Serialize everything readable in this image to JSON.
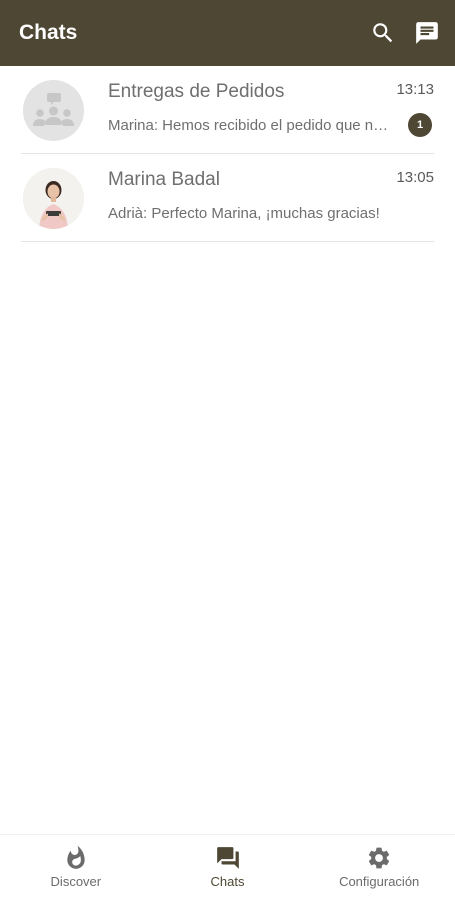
{
  "appbar": {
    "title": "Chats",
    "icons": [
      "search-icon",
      "new-message-icon"
    ]
  },
  "chats": [
    {
      "name": "Entregas de Pedidos",
      "time": "13:13",
      "preview": "Marina: Hemos recibido el pedido que nos enviasteis",
      "unread": "1",
      "avatar": "group-avatar-icon"
    },
    {
      "name": "Marina Badal",
      "time": "13:05",
      "preview": "Adrià: Perfecto Marina, ¡muchas gracias!",
      "avatar": "person-photo"
    }
  ],
  "bottom_nav": {
    "items": [
      {
        "label": "Discover",
        "icon": "flame-icon",
        "active": false
      },
      {
        "label": "Chats",
        "icon": "chats-icon",
        "active": true
      },
      {
        "label": "Configuración",
        "icon": "gear-icon",
        "active": false
      }
    ]
  },
  "colors": {
    "primary": "#4e4733",
    "text_secondary": "#6f6f6f",
    "divider": "#e4e4e4"
  }
}
